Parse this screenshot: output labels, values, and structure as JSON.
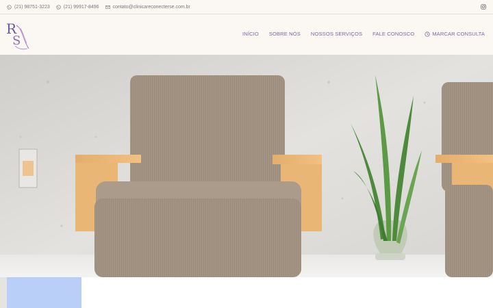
{
  "topbar": {
    "phone1": "(21) 98751-3223",
    "phone2": "(21) 99917-8496",
    "email": "contato@clinicareconecterse.com.br"
  },
  "nav": {
    "items": [
      "INÍCIO",
      "SOBRE NÓS",
      "NOSSOS SERVIÇOS",
      "FALE CONOSCO"
    ],
    "cta": "MARCAR CONSULTA"
  },
  "logo": {
    "letters": "RS",
    "script": "Reconecte-se"
  },
  "colors": {
    "brand": "#7d68a6",
    "bar": "#fbf7f3",
    "accent_box": "#b9cff7"
  },
  "icons": {
    "phone": "whatsapp-icon",
    "email": "envelope-icon",
    "social": "instagram-icon",
    "cta": "calendar-icon"
  }
}
